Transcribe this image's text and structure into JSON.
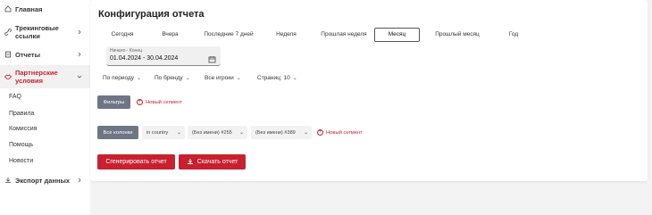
{
  "sidebar": {
    "items": [
      {
        "label": "Главная",
        "icon": "home-icon"
      },
      {
        "label": "Трекинговые ссылки",
        "label_line1": "Трекинговые",
        "label_line2": "ссылки",
        "icon": "link-icon"
      },
      {
        "label": "Отчеты",
        "icon": "file-icon"
      },
      {
        "label": "Партнерские условия",
        "label_line1": "Партнерские",
        "label_line2": "условия",
        "icon": "handshake-icon"
      },
      {
        "label": "Экспорт данных",
        "icon": "download-icon"
      }
    ],
    "sub_items": [
      "FAQ",
      "Правила",
      "Комиссия",
      "Помощь",
      "Новости"
    ]
  },
  "main": {
    "title": "Конфигурация отчета",
    "tabs": [
      "Сегодня",
      "Вчера",
      "Последние 7 дней",
      "Неделя",
      "Прошлая неделя",
      "Месяц",
      "Прошлый месяц",
      "Год"
    ],
    "selected_tab": "Месяц",
    "date_field": {
      "caption": "Начало - Конец",
      "value": "01.04.2024 - 30.04.2024"
    },
    "dropdowns": [
      "По периоду",
      "По бренду",
      "Все игроки",
      "Страниц: 10"
    ],
    "filters_button": "Фильтры",
    "new_segment_1": "Новый сегмент",
    "columns_button": "Все колонки",
    "chips": [
      "in country",
      "(Без имени) #255",
      "(Без имени) #389"
    ],
    "new_segment_2": "Новый сегмент",
    "generate_button": "Сгенерировать отчет",
    "download_button": "Скачать отчет"
  },
  "colors": {
    "accent": "#c8202f",
    "dark_button": "#6e7585",
    "background": "#f3f3f3"
  }
}
